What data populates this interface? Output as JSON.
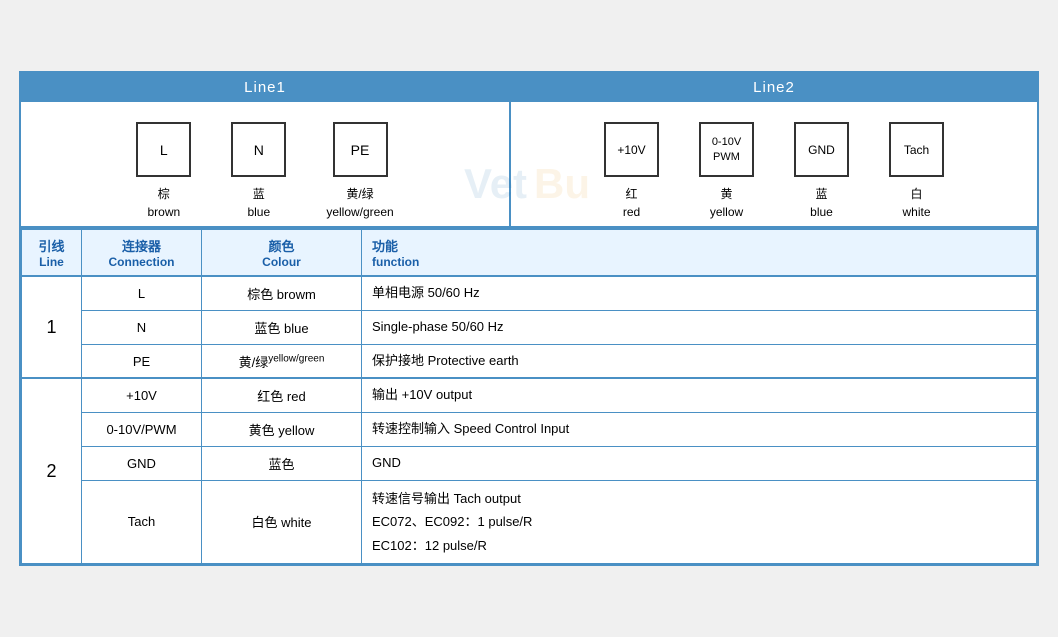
{
  "header": {
    "line1_label": "Line1",
    "line2_label": "Line2"
  },
  "line1_connectors": [
    {
      "id": "L",
      "label_cn": "棕",
      "label_en": "brown"
    },
    {
      "id": "N",
      "label_cn": "蓝",
      "label_en": "blue"
    },
    {
      "id": "PE",
      "label_cn": "黄/绿",
      "label_en": "yellow/green"
    }
  ],
  "line2_connectors": [
    {
      "id": "+10V",
      "label_cn": "红",
      "label_en": "red"
    },
    {
      "id": "0-10V\nPWM",
      "label_cn": "黄",
      "label_en": "yellow"
    },
    {
      "id": "GND",
      "label_cn": "蓝",
      "label_en": "blue"
    },
    {
      "id": "Tach",
      "label_cn": "白",
      "label_en": "white"
    }
  ],
  "table": {
    "headers": {
      "line_cn": "引线",
      "line_en": "Line",
      "conn_cn": "连接器",
      "conn_en": "Connection",
      "colour_cn": "颜色",
      "colour_en": "Colour",
      "func_cn": "功能",
      "func_en": "function"
    },
    "rows": [
      {
        "line_group": "1",
        "entries": [
          {
            "conn": "L",
            "colour_cn": "棕色",
            "colour_en": "browm",
            "func": "单相电源 50/60 Hz"
          },
          {
            "conn": "N",
            "colour_cn": "蓝色",
            "colour_en": "blue",
            "func": "Single-phase 50/60 Hz"
          },
          {
            "conn": "PE",
            "colour_cn": "黄/绿",
            "colour_en_small": "yellow/green",
            "func": "保护接地 Protective earth"
          }
        ]
      },
      {
        "line_group": "2",
        "entries": [
          {
            "conn": "+10V",
            "colour_cn": "红色",
            "colour_en": "red",
            "func": "输出 +10V output"
          },
          {
            "conn": "0-10V/PWM",
            "colour_cn": "黄色",
            "colour_en": "yellow",
            "func": "转速控制输入 Speed Control Input"
          },
          {
            "conn": "GND",
            "colour_cn": "蓝色",
            "colour_en": "",
            "func": "GND"
          },
          {
            "conn": "Tach",
            "colour_cn": "白色",
            "colour_en": "white",
            "func": "转速信号输出 Tach output\nEC072、EC092：1 pulse/R\nEC102：12 pulse/R"
          }
        ]
      }
    ]
  }
}
